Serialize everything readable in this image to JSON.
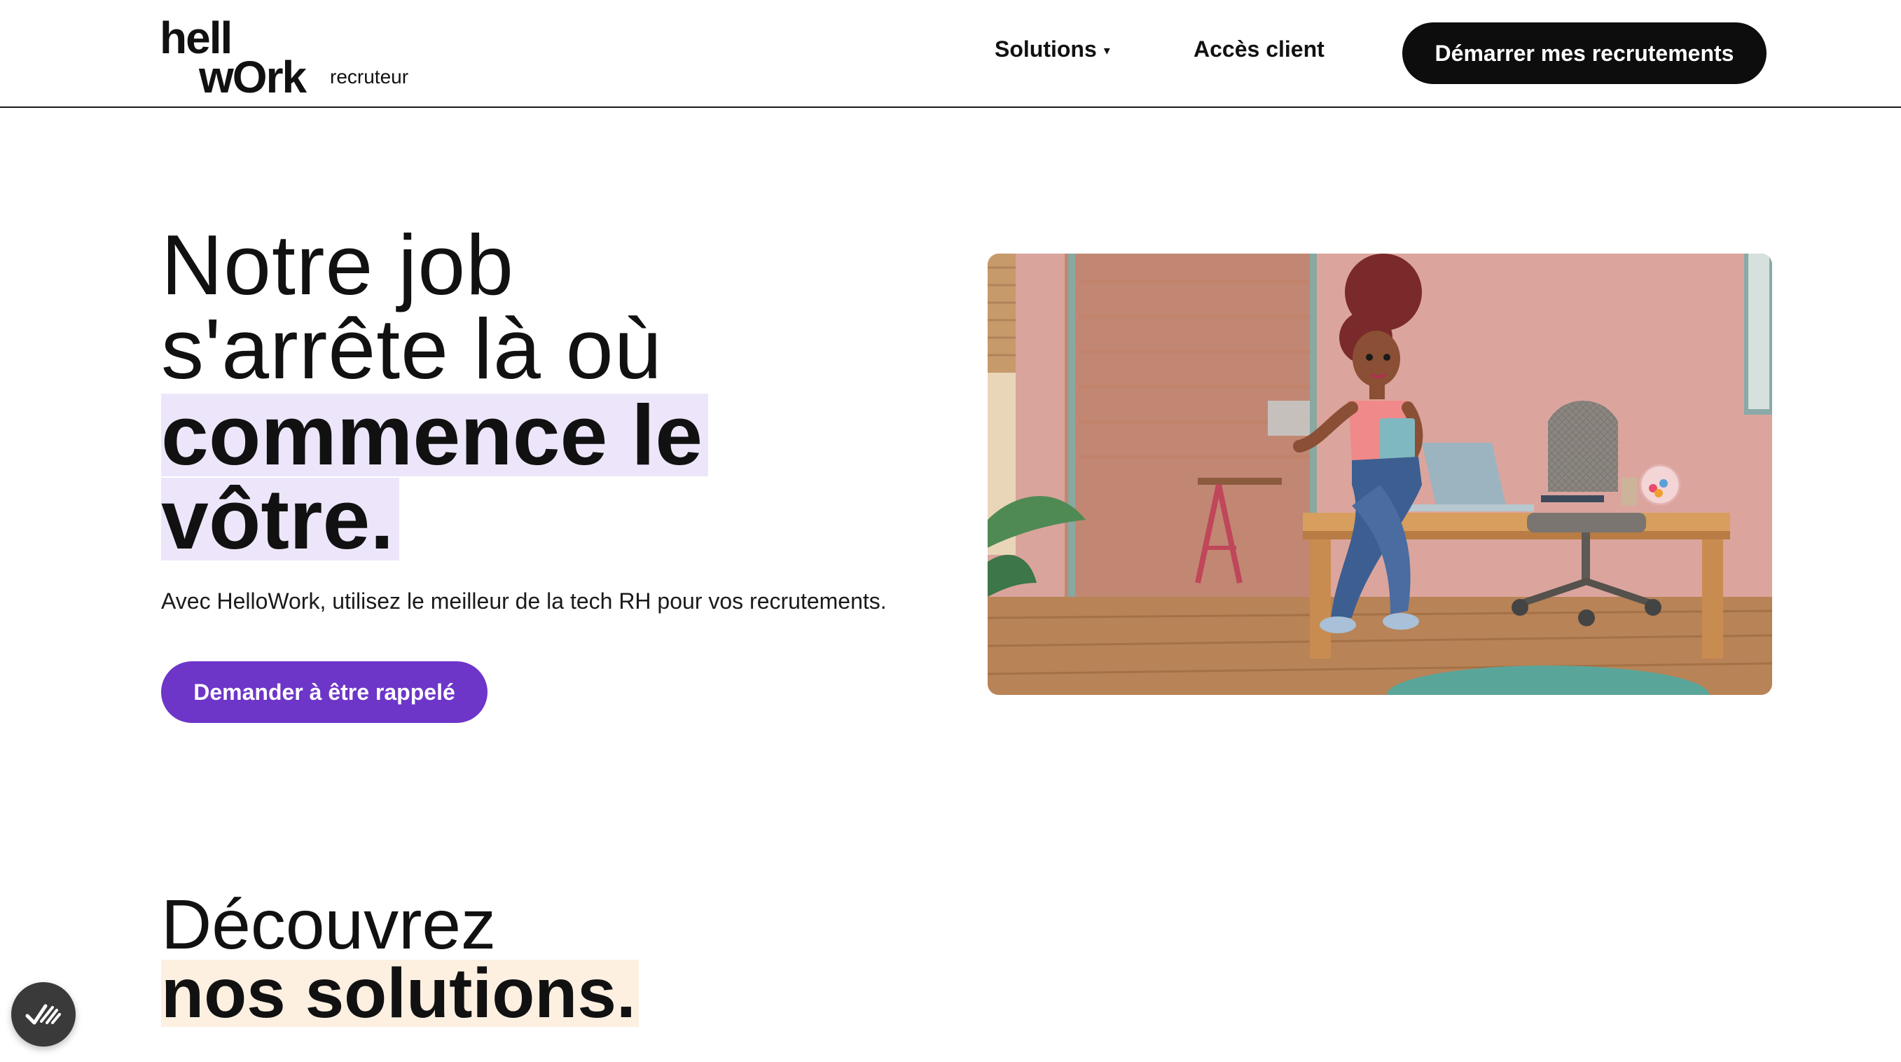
{
  "header": {
    "logo_word_top": "hell",
    "logo_word_bottom": "wOrk",
    "logo_sub": "recruteur",
    "nav_solutions": "Solutions",
    "nav_acces": "Accès client",
    "cta_label": "Démarrer mes recrutements"
  },
  "hero": {
    "title_line1": "Notre job",
    "title_line2": "s'arrête là où",
    "title_bold1": "commence le",
    "title_bold2": "vôtre.",
    "subtitle": "Avec HelloWork, utilisez le meilleur de la tech RH pour vos recrutements.",
    "cta_label": "Demander à être rappelé"
  },
  "solutions": {
    "title_light": "Découvrez",
    "title_bold": "nos solutions."
  },
  "colors": {
    "accent_purple": "#6d35c8",
    "highlight_lavender": "#ede6fb",
    "highlight_peach": "#fdf0e1",
    "dark": "#0d0d0d"
  },
  "icons": {
    "caret": "chevron-down-icon",
    "badge": "check-lines-icon"
  }
}
